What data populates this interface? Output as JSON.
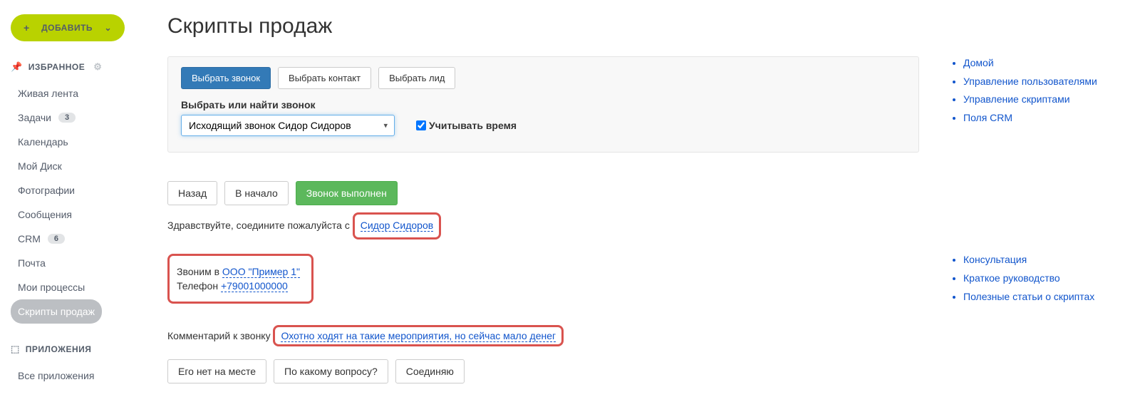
{
  "sidebar": {
    "add_label": "ДОБАВИТЬ",
    "favorites_title": "ИЗБРАННОЕ",
    "apps_title": "ПРИЛОЖЕНИЯ",
    "items": [
      {
        "label": "Живая лента",
        "badge": null
      },
      {
        "label": "Задачи",
        "badge": "3"
      },
      {
        "label": "Календарь",
        "badge": null
      },
      {
        "label": "Мой Диск",
        "badge": null
      },
      {
        "label": "Фотографии",
        "badge": null
      },
      {
        "label": "Сообщения",
        "badge": null
      },
      {
        "label": "CRM",
        "badge": "6"
      },
      {
        "label": "Почта",
        "badge": null
      },
      {
        "label": "Мои процессы",
        "badge": null
      },
      {
        "label": "Скрипты продаж",
        "badge": null,
        "active": true
      }
    ],
    "apps_items": [
      {
        "label": "Все приложения"
      }
    ]
  },
  "page": {
    "title": "Скрипты продаж"
  },
  "panel": {
    "tabs": [
      "Выбрать звонок",
      "Выбрать контакт",
      "Выбрать лид"
    ],
    "select_label": "Выбрать или найти звонок",
    "select_value": "Исходящий звонок Сидор Сидоров",
    "checkbox_label": "Учитывать время"
  },
  "actions": {
    "back": "Назад",
    "start": "В начало",
    "done": "Звонок выполнен"
  },
  "script": {
    "greeting_prefix": "Здравствуйте, соедините пожалуйста с",
    "contact_name": "Сидор Сидоров",
    "calling_prefix": "Звоним в",
    "company": "ООО \"Пример 1\"",
    "phone_label": "Телефон",
    "phone": "+79001000000",
    "comment_label": "Комментарий к звонку",
    "comment_text": "Охотно ходят на такие мероприятия, но сейчас мало денег",
    "options": [
      "Его нет на месте",
      "По какому вопросу?",
      "Соединяю"
    ]
  },
  "sidelinks": {
    "top": [
      "Домой",
      "Управление пользователями",
      "Управление скриптами",
      "Поля CRM"
    ],
    "bottom": [
      "Консультация",
      "Краткое руководство",
      "Полезные статьи о скриптах"
    ]
  }
}
